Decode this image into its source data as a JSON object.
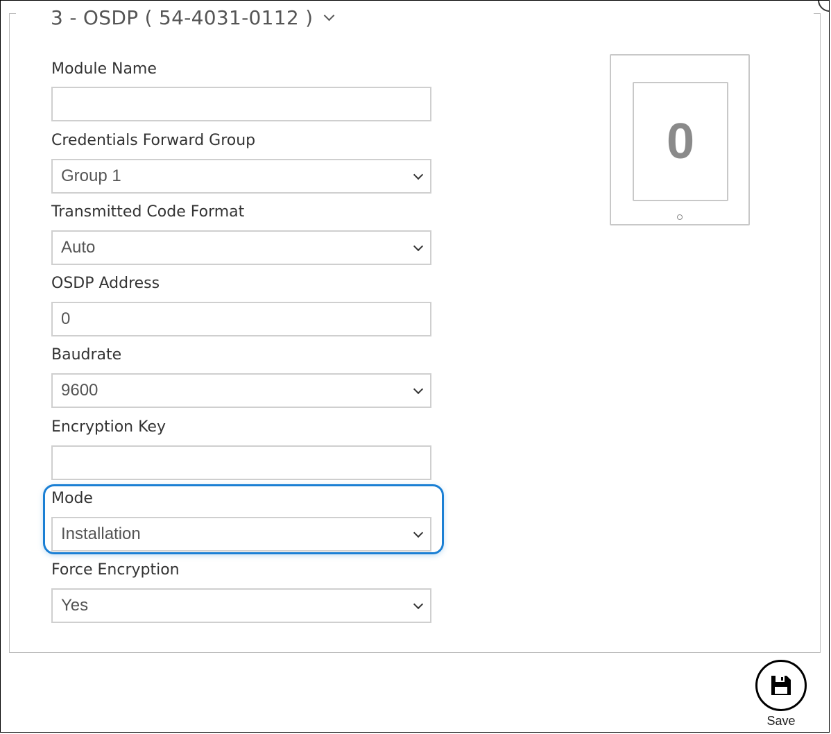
{
  "section": {
    "title": "3 - OSDP ( 54-4031-0112 )"
  },
  "fields": {
    "module_name": {
      "label": "Module Name",
      "value": ""
    },
    "credentials_forward_group": {
      "label": "Credentials Forward Group",
      "value": "Group 1"
    },
    "transmitted_code_format": {
      "label": "Transmitted Code Format",
      "value": "Auto"
    },
    "osdp_address": {
      "label": "OSDP Address",
      "value": "0"
    },
    "baudrate": {
      "label": "Baudrate",
      "value": "9600"
    },
    "encryption_key": {
      "label": "Encryption Key",
      "value": ""
    },
    "mode": {
      "label": "Mode",
      "value": "Installation"
    },
    "force_encryption": {
      "label": "Force Encryption",
      "value": "Yes"
    }
  },
  "device_preview": {
    "display_value": "0"
  },
  "actions": {
    "save_label": "Save"
  },
  "colors": {
    "highlight": "#1a7fd4",
    "border": "#cfcfcf"
  }
}
